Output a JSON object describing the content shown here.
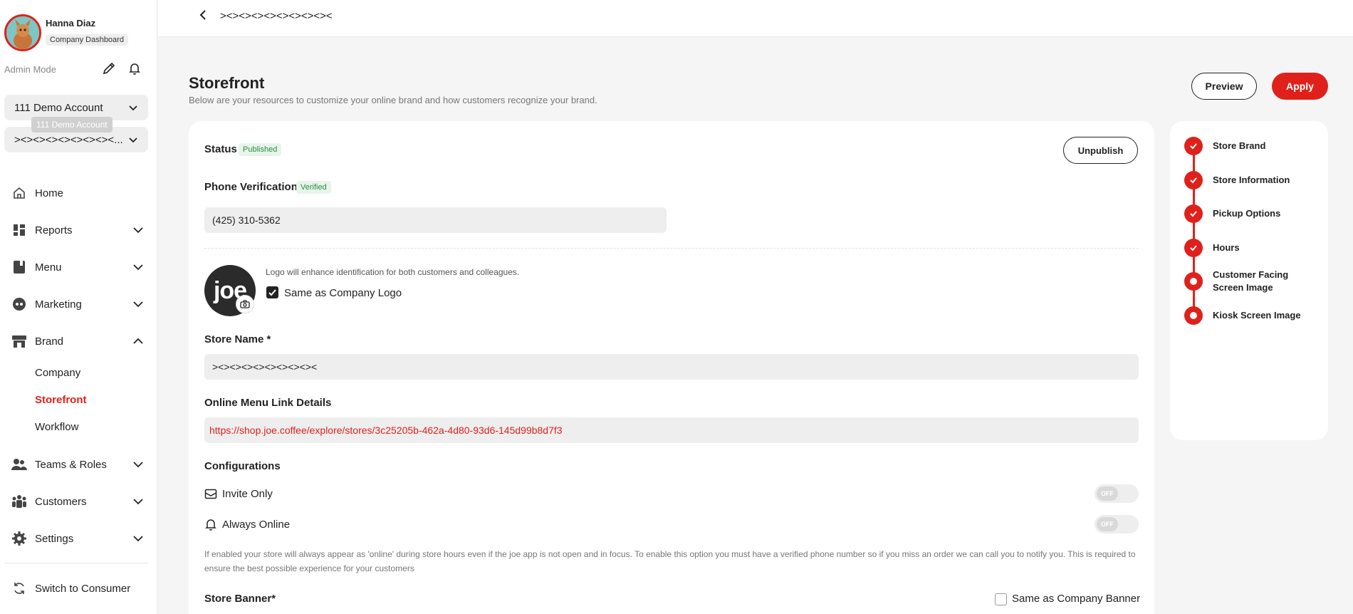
{
  "user": {
    "name": "Hanna Diaz",
    "role": "Company Dashboard"
  },
  "admin_mode": "Admin Mode",
  "account_select": {
    "value": "111 Demo Account",
    "tooltip": "111 Demo Account"
  },
  "store_select": {
    "value": "><><><><><><><><..."
  },
  "nav": {
    "home": "Home",
    "reports": "Reports",
    "menu": "Menu",
    "marketing": "Marketing",
    "brand": "Brand",
    "brand_sub": {
      "company": "Company",
      "storefront": "Storefront",
      "workflow": "Workflow"
    },
    "teams": "Teams & Roles",
    "customers": "Customers",
    "settings": "Settings",
    "switch": "Switch to Consumer"
  },
  "breadcrumb": "><><><><><><><><><",
  "header": {
    "title": "Storefront",
    "subtitle": "Below are your resources to customize your online brand and how customers recognize your brand.",
    "preview_label": "Preview",
    "apply_label": "Apply"
  },
  "form": {
    "status_label": "Status",
    "status_badge": "Published",
    "unpublish_label": "Unpublish",
    "phone_label": "Phone Verification",
    "phone_badge": "Verified",
    "phone_value": "(425) 310-5362",
    "logo_text": "joe",
    "logo_note": "Logo will enhance identification for both customers and colleagues.",
    "same_logo_label": "Same as Company Logo",
    "store_name_label": "Store Name *",
    "store_name_value": "><><><><><><><><><",
    "link_label": "Online Menu Link Details",
    "link_value": "https://shop.joe.coffee/explore/stores/3c25205b-462a-4d80-93d6-145d99b8d7f3",
    "config_label": "Configurations",
    "invite_only_label": "Invite Only",
    "invite_only_state": "OFF",
    "always_online_label": "Always Online",
    "always_online_state": "OFF",
    "help_text": "If enabled your store will always appear as 'online' during store hours even if the joe app is not open and in focus. To enable this option you must have a verified phone number so if you miss an order we can call you to notify you. This is required to ensure the best possible experience for your customers",
    "banner_label": "Store Banner*",
    "same_banner_label": "Same as Company Banner"
  },
  "steps": [
    {
      "label": "Store Brand",
      "done": true
    },
    {
      "label": "Store Information",
      "done": true
    },
    {
      "label": "Pickup Options",
      "done": true
    },
    {
      "label": "Hours",
      "done": true
    },
    {
      "label": "Customer Facing Screen Image",
      "done": false
    },
    {
      "label": "Kiosk Screen Image",
      "done": false
    }
  ],
  "colors": {
    "accent": "#e0211b",
    "success": "#2e8b46"
  }
}
